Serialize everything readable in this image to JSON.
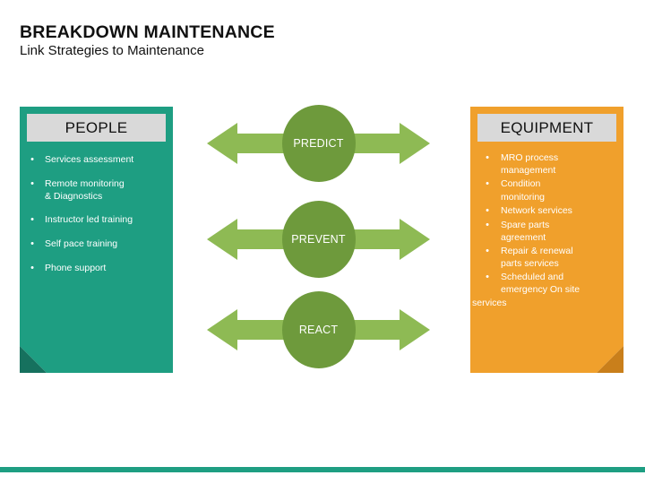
{
  "header": {
    "title": "BREAKDOWN MAINTENANCE",
    "subtitle": "Link Strategies to Maintenance"
  },
  "colors": {
    "teal": "#1E9E82",
    "teal_fold": "#16715E",
    "orange": "#F0A02C",
    "orange_fold": "#C97F1B",
    "circle_green": "#6E9A3C",
    "arrow_green": "#8EBA54",
    "header_band_gray": "#D9D9D9",
    "text_dark": "#111111",
    "text_light": "#FFFFFF"
  },
  "panels": {
    "people": {
      "heading": "PEOPLE",
      "bullet_glyph": "•",
      "items": [
        {
          "line1": "Services assessment",
          "line2": ""
        },
        {
          "line1": "Remote monitoring",
          "line2": "& Diagnostics"
        },
        {
          "line1": "Instructor led training",
          "line2": ""
        },
        {
          "line1": "Self pace training",
          "line2": ""
        },
        {
          "line1": "Phone support",
          "line2": ""
        }
      ]
    },
    "equipment": {
      "heading": "EQUIPMENT",
      "bullet_glyph": "•",
      "items": [
        {
          "line1": "MRO process",
          "line2": "management",
          "line3": ""
        },
        {
          "line1": "Condition",
          "line2": "monitoring",
          "line3": ""
        },
        {
          "line1": "Network services",
          "line2": "",
          "line3": ""
        },
        {
          "line1": "Spare parts",
          "line2": "agreement",
          "line3": ""
        },
        {
          "line1": "Repair & renewal",
          "line2": "parts services",
          "line3": ""
        },
        {
          "line1": "Scheduled and",
          "line2": "emergency  On site",
          "line3": "services"
        }
      ]
    }
  },
  "diagram": {
    "stages": [
      {
        "label": "PREDICT"
      },
      {
        "label": "PREVENT"
      },
      {
        "label": "REACT"
      }
    ],
    "arrow_left_name": "arrow-left-icon",
    "arrow_right_name": "arrow-right-icon"
  }
}
